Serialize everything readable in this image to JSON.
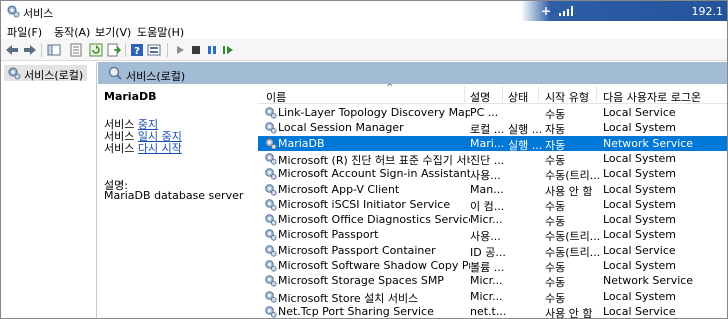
{
  "window": {
    "title": "서비스",
    "remote_ip": "192.1"
  },
  "menu": [
    "파일(F)",
    "동작(A)",
    "보기(V)",
    "도움말(H)"
  ],
  "toolbar": {
    "icons": [
      "back-arrow-icon",
      "forward-arrow-icon",
      "show-hide-tree-icon",
      "properties-icon",
      "refresh-icon",
      "export-list-icon",
      "help-icon",
      "view-icon",
      "play-icon",
      "stop-icon",
      "pause-icon",
      "restart-icon"
    ]
  },
  "tree": {
    "root_label": "서비스(로컬)"
  },
  "pane": {
    "header_label": "서비스(로컬)"
  },
  "details": {
    "service_name": "MariaDB",
    "actions": [
      {
        "prefix": "서비스 ",
        "link": "중지"
      },
      {
        "prefix": "서비스 ",
        "link": "일시 중지"
      },
      {
        "prefix": "서비스 ",
        "link": "다시 시작"
      }
    ],
    "description_label": "설명:",
    "description_text": "MariaDB database server"
  },
  "columns": {
    "name": "이름",
    "description": "설명",
    "status": "상태",
    "startup_type": "시작 유형",
    "logon_as": "다음 사용자로 로그온"
  },
  "services": [
    {
      "name": "Link-Layer Topology Discovery Mapper",
      "description": "PC ...",
      "status": "",
      "startup": "수동",
      "logon": "Local Service",
      "selected": false
    },
    {
      "name": "Local Session Manager",
      "description": "로컬 ...",
      "status": "실행 ...",
      "startup": "자동",
      "logon": "Local System",
      "selected": false
    },
    {
      "name": "MariaDB",
      "description": "Mari...",
      "status": "실행 ...",
      "startup": "자동",
      "logon": "Network Service",
      "selected": true
    },
    {
      "name": "Microsoft (R) 진단 허브 표준 수집기 서비스",
      "description": "진단 ...",
      "status": "",
      "startup": "수동",
      "logon": "Local System",
      "selected": false
    },
    {
      "name": "Microsoft Account Sign-in Assistant",
      "description": "사용...",
      "status": "",
      "startup": "수동(트리...",
      "logon": "Local System",
      "selected": false
    },
    {
      "name": "Microsoft App-V Client",
      "description": "Man...",
      "status": "",
      "startup": "사용 안 함",
      "logon": "Local System",
      "selected": false
    },
    {
      "name": "Microsoft iSCSI Initiator Service",
      "description": "이 컴...",
      "status": "",
      "startup": "수동",
      "logon": "Local System",
      "selected": false
    },
    {
      "name": "Microsoft Office Diagnostics Service",
      "description": "Micr...",
      "status": "",
      "startup": "수동",
      "logon": "Local System",
      "selected": false
    },
    {
      "name": "Microsoft Passport",
      "description": "사용...",
      "status": "",
      "startup": "수동(트리...",
      "logon": "Local System",
      "selected": false
    },
    {
      "name": "Microsoft Passport Container",
      "description": "ID 공...",
      "status": "",
      "startup": "수동(트리...",
      "logon": "Local Service",
      "selected": false
    },
    {
      "name": "Microsoft Software Shadow Copy Provider",
      "description": "볼륨 ...",
      "status": "",
      "startup": "수동",
      "logon": "Local System",
      "selected": false
    },
    {
      "name": "Microsoft Storage Spaces SMP",
      "description": "Micr...",
      "status": "",
      "startup": "수동",
      "logon": "Network Service",
      "selected": false
    },
    {
      "name": "Microsoft Store 설치 서비스",
      "description": "Micr...",
      "status": "",
      "startup": "수동",
      "logon": "Local System",
      "selected": false
    },
    {
      "name": "Net.Tcp Port Sharing Service",
      "description": "net.t...",
      "status": "",
      "startup": "사용 안 함",
      "logon": "Local Service",
      "selected": false
    }
  ],
  "colors": {
    "selection": "#0078d7",
    "pane_header": "#a3bcd6",
    "link": "#1a4cb3",
    "rdp_bar": "#23549a"
  }
}
